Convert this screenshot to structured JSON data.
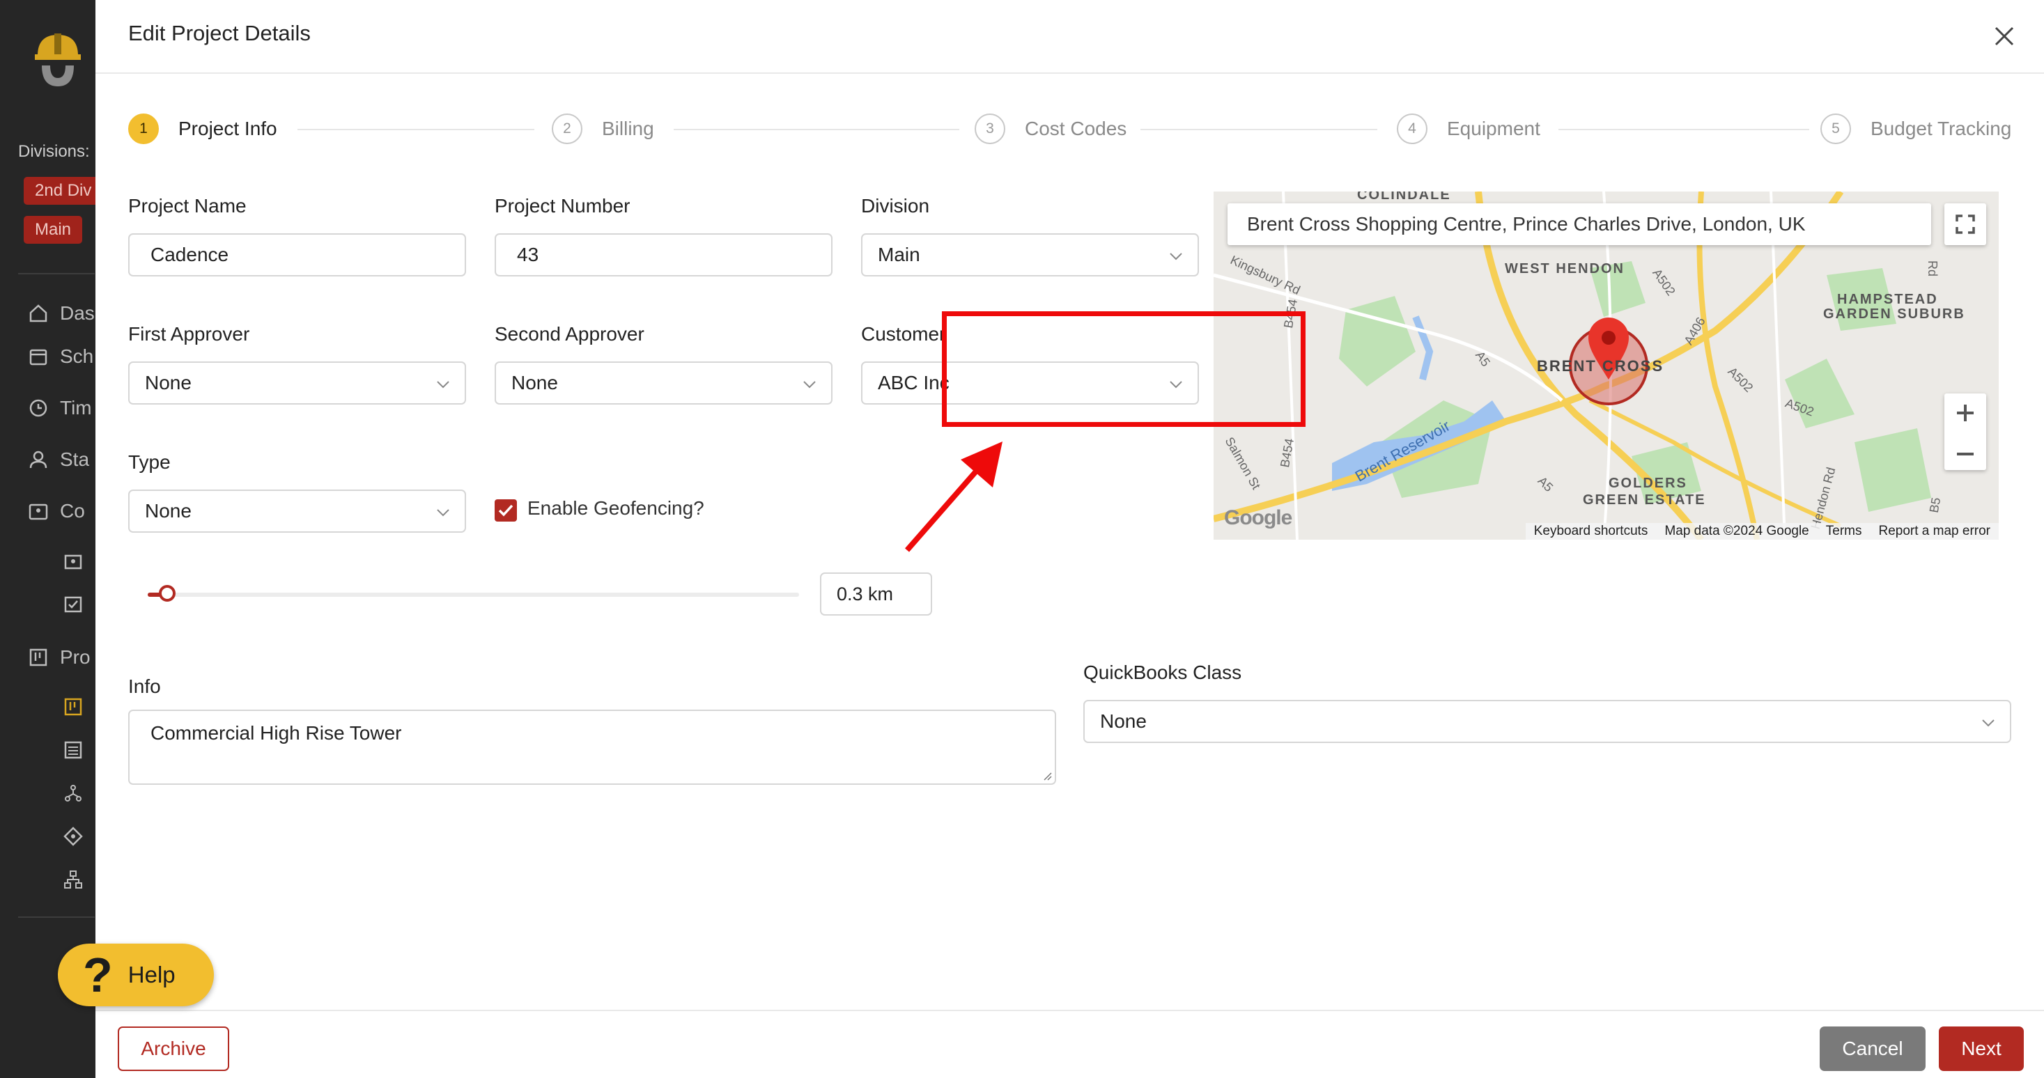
{
  "sidebar": {
    "divisions_label": "Divisions:",
    "badges": [
      "2nd Div",
      "Main"
    ],
    "items": [
      "Das",
      "Sch",
      "Tim",
      "Sta",
      "Co",
      "Pro"
    ]
  },
  "modal": {
    "title": "Edit Project Details",
    "steps": [
      {
        "num": "1",
        "label": "Project Info"
      },
      {
        "num": "2",
        "label": "Billing"
      },
      {
        "num": "3",
        "label": "Cost Codes"
      },
      {
        "num": "4",
        "label": "Equipment"
      },
      {
        "num": "5",
        "label": "Budget Tracking"
      }
    ],
    "fields": {
      "project_name": {
        "label": "Project Name",
        "value": "Cadence"
      },
      "project_number": {
        "label": "Project Number",
        "value": "43"
      },
      "division": {
        "label": "Division",
        "value": "Main"
      },
      "first_approver": {
        "label": "First Approver",
        "value": "None"
      },
      "second_approver": {
        "label": "Second Approver",
        "value": "None"
      },
      "customer": {
        "label": "Customer",
        "value": "ABC Inc"
      },
      "type": {
        "label": "Type",
        "value": "None"
      },
      "geofencing": {
        "label": "Enable Geofencing?",
        "checked": true
      },
      "radius": {
        "value": "0.3 km",
        "slider_fraction": 0.03
      },
      "info": {
        "label": "Info",
        "value": "Commercial High Rise Tower"
      },
      "quickbooks_class": {
        "label": "QuickBooks Class",
        "value": "None"
      }
    },
    "map": {
      "search_value": "Brent Cross Shopping Centre, Prince Charles Drive, London, UK",
      "places": [
        "COLINDALE",
        "WEST HENDON",
        "HAMPSTEAD",
        "GARDEN SUBURB",
        "BRENT CROSS",
        "GOLDERS",
        "GREEN ESTATE"
      ],
      "roads": [
        "Kingsbury Rd",
        "B454",
        "A502",
        "A406",
        "A5",
        "Brent Reservoir",
        "Salmon St",
        "Hendon Rd",
        "Rd",
        "B5"
      ],
      "footer": [
        "Keyboard shortcuts",
        "Map data ©2024 Google",
        "Terms",
        "Report a map error"
      ],
      "logo": "Google"
    },
    "buttons": {
      "archive": "Archive",
      "cancel": "Cancel",
      "next": "Next"
    }
  },
  "help": {
    "label": "Help",
    "icon": "?"
  },
  "colors": {
    "brand_red": "#b22a22",
    "accent_yellow": "#f2be2f",
    "highlight": "#ee0a0a"
  }
}
